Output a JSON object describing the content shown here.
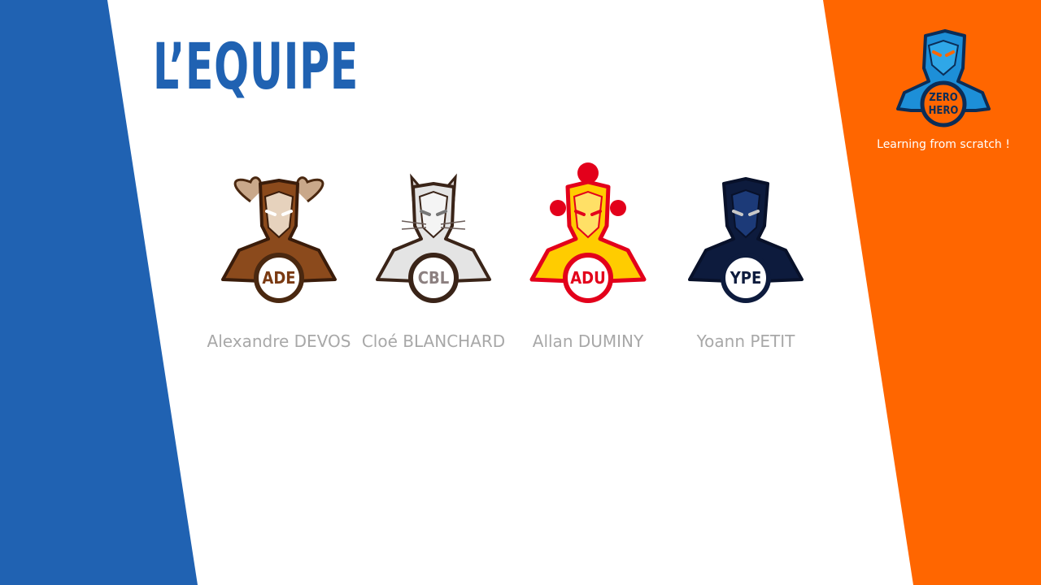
{
  "slide": {
    "title": "L’EQUIPE",
    "colors": {
      "blue": "#2062b2",
      "orange": "#ff6600",
      "name_gray": "#a8a8a8"
    }
  },
  "brand": {
    "logo_line1": "ZERO",
    "logo_line2": "HERO",
    "tagline": "Learning from scratch !"
  },
  "members": [
    {
      "initials": "ADE",
      "name": "Alexandre DEVOS",
      "icon": "ram-hero-avatar-icon",
      "color": "#7a3a12"
    },
    {
      "initials": "CBL",
      "name": "Cloé BLANCHARD",
      "icon": "cat-hero-avatar-icon",
      "color": "#8c8080"
    },
    {
      "initials": "ADU",
      "name": "Allan DUMINY",
      "icon": "robot-hero-avatar-icon",
      "color": "#e3001b"
    },
    {
      "initials": "YPE",
      "name": "Yoann PETIT",
      "icon": "masked-hero-avatar-icon",
      "color": "#0d1b3d"
    }
  ]
}
